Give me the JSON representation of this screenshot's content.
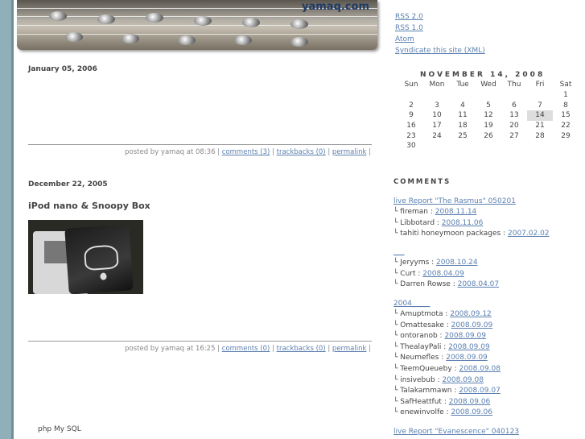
{
  "site": {
    "title": "yamaq.com"
  },
  "posts": [
    {
      "date": "January 05, 2006",
      "title": "",
      "posted_by": "posted by yamaq at 08:36 |",
      "comments": "comments (3)",
      "trackbacks": "trackbacks (0)",
      "permalink": "permalink",
      "sep": "|"
    },
    {
      "date": "December 22, 2005",
      "title": "iPod nano & Snoopy Box",
      "posted_by": "posted by yamaq at 16:25 |",
      "comments": "comments (0)",
      "trackbacks": "trackbacks (0)",
      "permalink": "permalink",
      "sep": "|"
    }
  ],
  "footer": {
    "text": "php  My SQL"
  },
  "sidebar": {
    "feeds": [
      "RSS 2.0",
      "RSS 1.0",
      "Atom",
      "Syndicate this site (XML)"
    ],
    "calendar": {
      "title": "NOVEMBER 14, 2008",
      "days": [
        "Sun",
        "Mon",
        "Tue",
        "Wed",
        "Thu",
        "Fri",
        "Sat"
      ],
      "weeks": [
        [
          "",
          "",
          "",
          "",
          "",
          "",
          "1"
        ],
        [
          "2",
          "3",
          "4",
          "5",
          "6",
          "7",
          "8"
        ],
        [
          "9",
          "10",
          "11",
          "12",
          "13",
          "14",
          "15"
        ],
        [
          "16",
          "17",
          "18",
          "19",
          "20",
          "21",
          "22"
        ],
        [
          "23",
          "24",
          "25",
          "26",
          "27",
          "28",
          "29"
        ],
        [
          "30",
          "",
          "",
          "",
          "",
          "",
          ""
        ]
      ],
      "today": "14"
    },
    "comments_title": "COMMENTS",
    "comment_groups": [
      {
        "title": "live Report \"The Rasmus\" 050201",
        "items": [
          {
            "author": "fireman",
            "date": "2008.11.14"
          },
          {
            "author": "Libbotard",
            "date": "2008.11.06"
          },
          {
            "author": "tahiti honeymoon packages",
            "date": "2007.02.02"
          }
        ]
      },
      {
        "title": "___",
        "items": [
          {
            "author": "Jeryyms",
            "date": "2008.10.24"
          },
          {
            "author": "Curt",
            "date": "2008.04.09"
          },
          {
            "author": "Darren Rowse",
            "date": "2008.04.07"
          }
        ]
      },
      {
        "title": "2004_____",
        "items": [
          {
            "author": "Amuptmota",
            "date": "2008.09.12"
          },
          {
            "author": "Omattesake",
            "date": "2008.09.09"
          },
          {
            "author": "ontoranob",
            "date": "2008.09.09"
          },
          {
            "author": "ThealayPali",
            "date": "2008.09.09"
          },
          {
            "author": "Neumefles",
            "date": "2008.09.09"
          },
          {
            "author": "TeemQueueby",
            "date": "2008.09.08"
          },
          {
            "author": "insivebub",
            "date": "2008.09.08"
          },
          {
            "author": "Talakammawn",
            "date": "2008.09.07"
          },
          {
            "author": "SafHeattfut",
            "date": "2008.09.06"
          },
          {
            "author": "enewinvolfe",
            "date": "2008.09.06"
          }
        ]
      },
      {
        "title": "live Report \"Evanescence\" 040123",
        "items": []
      }
    ]
  }
}
